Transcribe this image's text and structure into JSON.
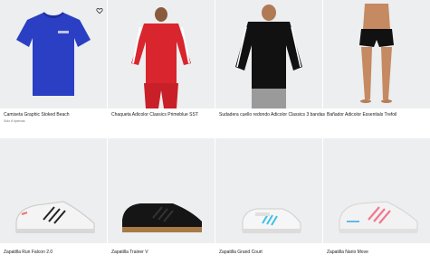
{
  "products": [
    {
      "title": "Camiseta Graphic Stoked Beach",
      "subtitle": "Sólo 6 tiptexas",
      "image": "blue-tshirt"
    },
    {
      "title": "Chaqueta Adicolor Classics Primeblue SST",
      "subtitle": "",
      "image": "red-track-jacket"
    },
    {
      "title": "Sudadera cuello redondo Adicolor Classics 3 bandas",
      "subtitle": "",
      "image": "black-sweatshirt"
    },
    {
      "title": "Bañador Adicolor Essentials Trefoil",
      "subtitle": "",
      "image": "black-swim-shorts"
    },
    {
      "title": "Zapatilla Run Falcon 2.0",
      "subtitle": "",
      "image": "white-running-shoe"
    },
    {
      "title": "Zapatilla Trainer V",
      "subtitle": "",
      "image": "black-trainer-shoe"
    },
    {
      "title": "Zapatilla Grand Court",
      "subtitle": "",
      "image": "white-court-shoe"
    },
    {
      "title": "Zapatilla Nario Move",
      "subtitle": "",
      "image": "white-pink-running-shoe"
    }
  ],
  "wishlist_icon": "heart-icon",
  "colors": {
    "tile_bg": "#eceeef",
    "blue": "#2a3fc4",
    "red": "#d9252e",
    "black": "#111111"
  }
}
